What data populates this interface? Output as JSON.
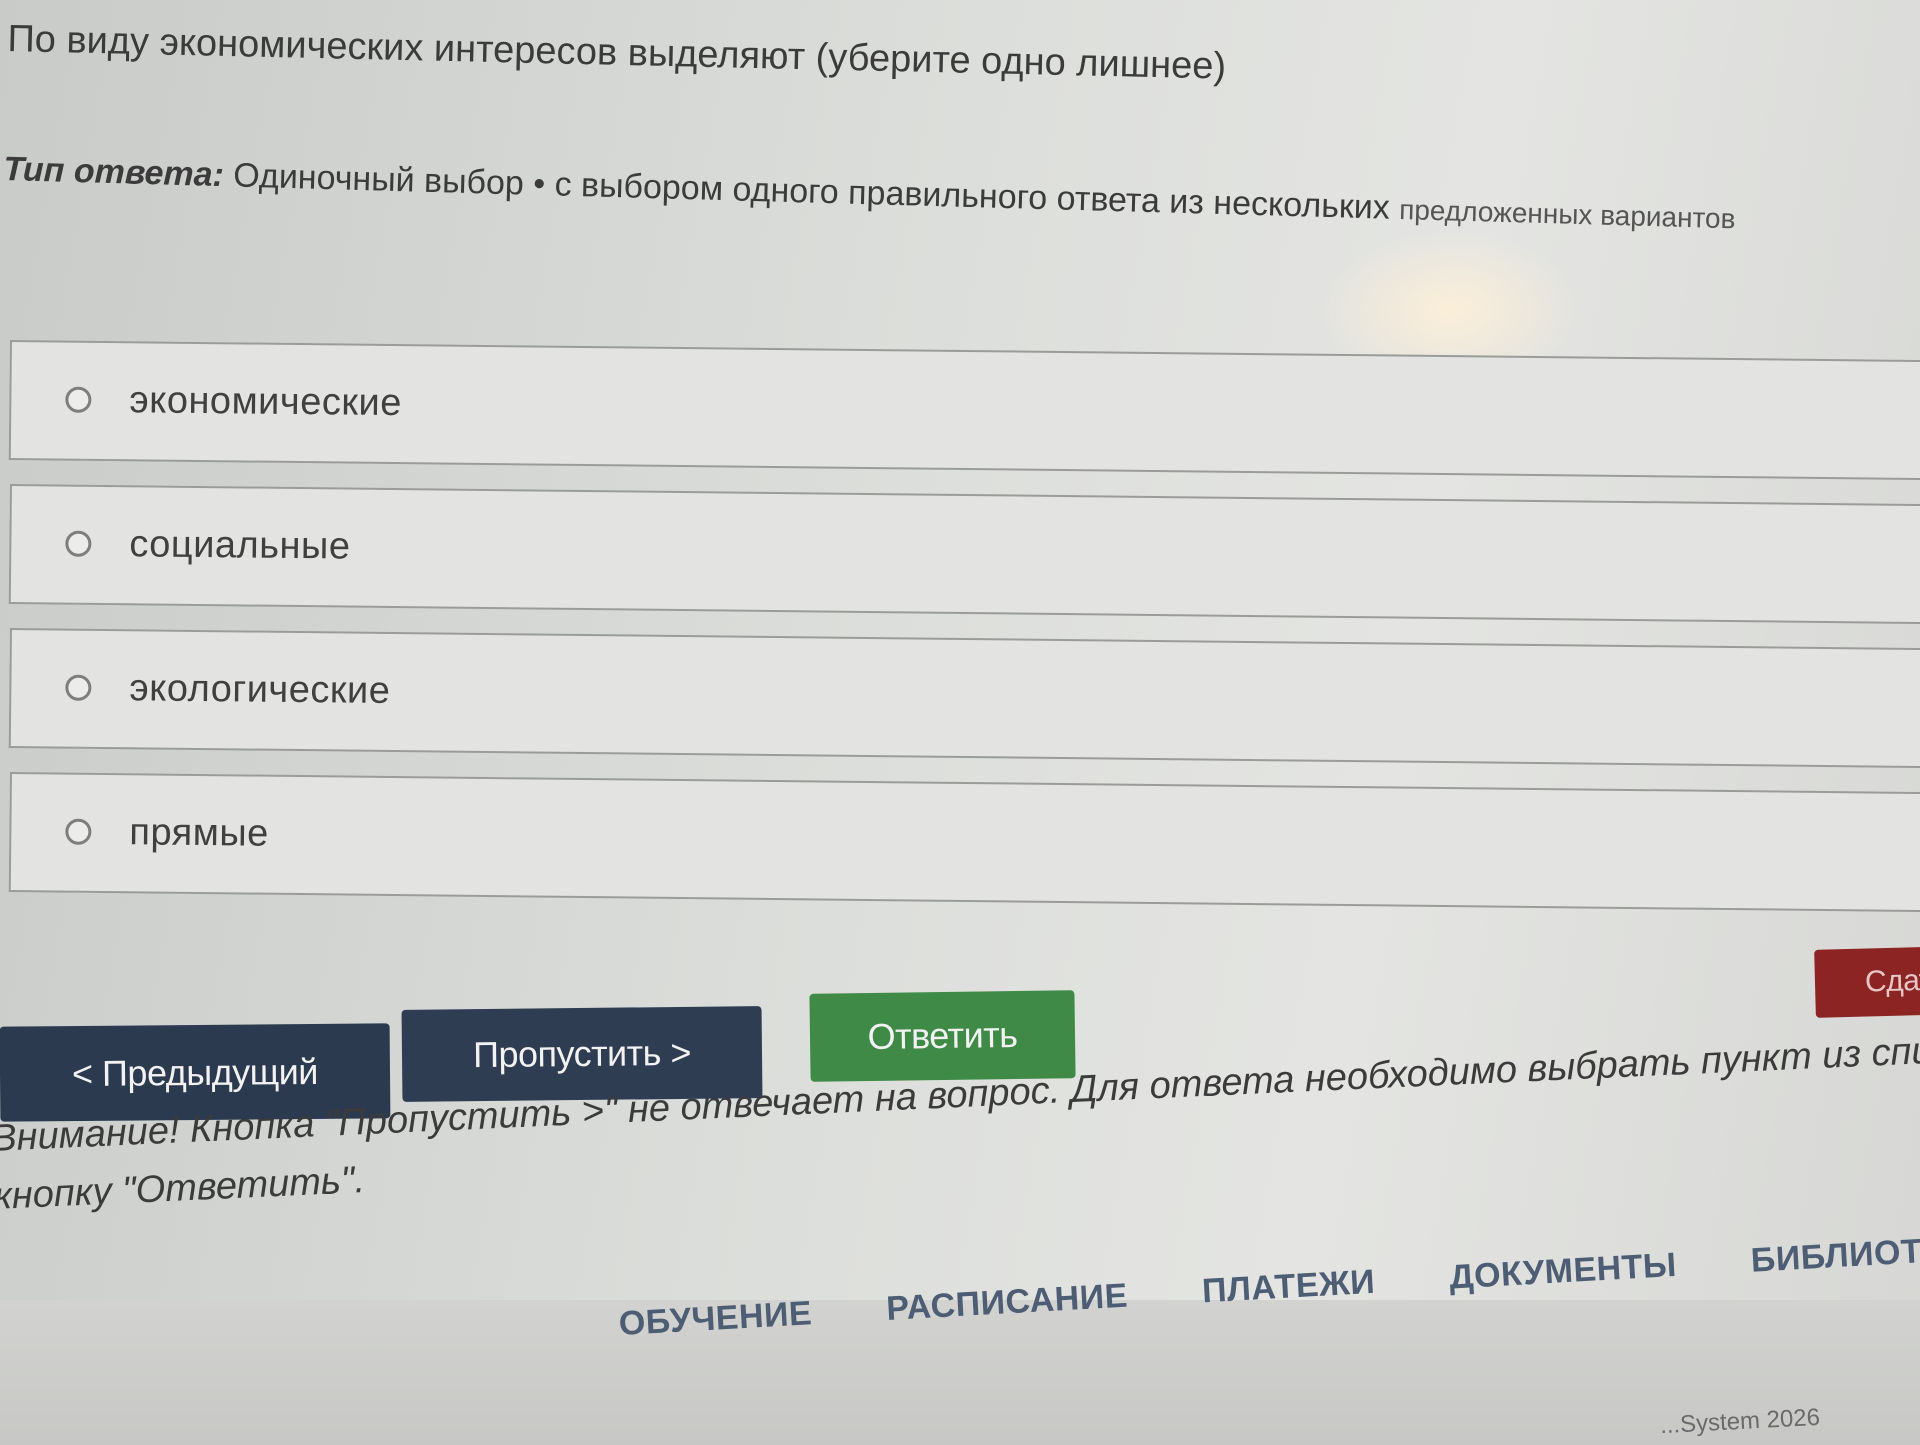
{
  "question": {
    "title": "По виду экономических интересов выделяют (уберите одно лишнее)",
    "answer_type_label": "Тип ответа:",
    "answer_type_value": " Одиночный выбор • с выбором одного правильного ответа из нескольких ",
    "answer_type_hint": "предложенных вариантов"
  },
  "options": [
    {
      "label": "экономические"
    },
    {
      "label": "социальные"
    },
    {
      "label": "экологические"
    },
    {
      "label": "прямые"
    }
  ],
  "buttons": {
    "prev": "< Предыдущий",
    "skip": "Пропустить >",
    "answer": "Ответить",
    "submit": "Сдат"
  },
  "warning": {
    "line1": "Внимание! Кнопка \"Пропустить >\" не отвечает на вопрос. Для ответа необходимо выбрать пункт из списка и на",
    "line2": "кнопку \"Ответить\"."
  },
  "footer": {
    "nav": [
      "ОБУЧЕНИЕ",
      "РАСПИСАНИЕ",
      "ПЛАТЕЖИ",
      "ДОКУМЕНТЫ",
      "БИБЛИОТЕКА"
    ],
    "copyright": "...System 2026"
  },
  "colors": {
    "prev_button": "#2b3a4f",
    "skip_button": "#2e3d52",
    "answer_button": "#3f8a46",
    "submit_button": "#8c2424",
    "nav_text": "#4d5d73"
  }
}
